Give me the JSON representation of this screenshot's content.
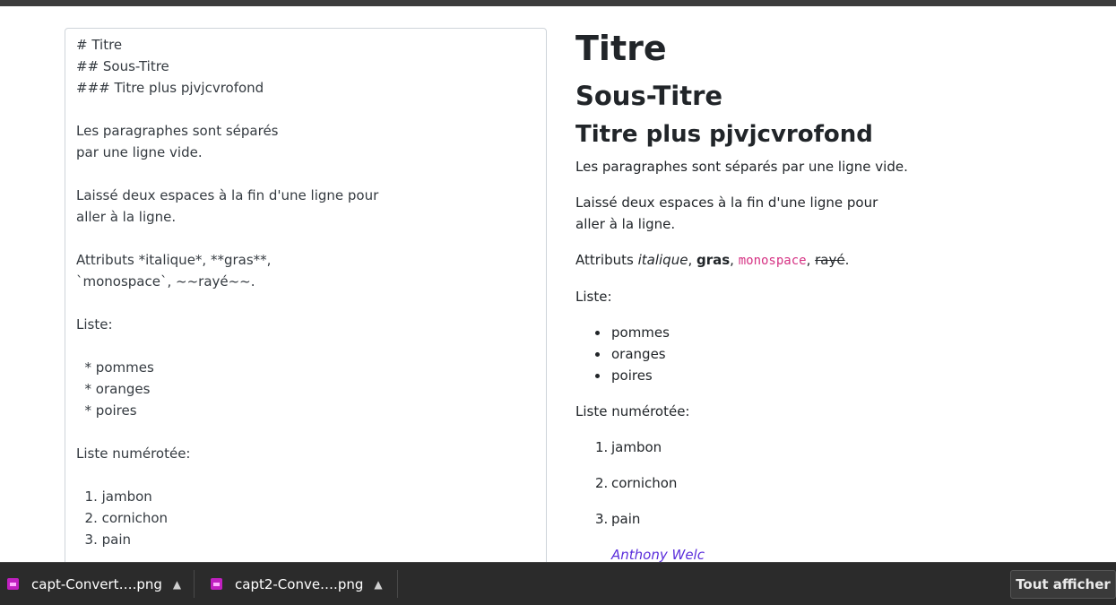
{
  "editor": {
    "lines": [
      "# Titre",
      "## Sous-Titre",
      "### Titre plus pjvjcvrofond",
      "",
      "Les paragraphes sont séparés",
      "par une ligne vide.",
      "",
      "Laissé deux espaces à la fin d'une ligne pour",
      "aller à la ligne.",
      "",
      "Attributs *italique*, **gras**,",
      "`monospace`, ~~rayé~~.",
      "",
      "Liste:",
      "",
      "  * pommes",
      "  * oranges",
      "  * poires",
      "",
      "Liste numérotée:",
      "",
      "  1. jambon",
      "  2. cornichon",
      "  3. pain"
    ]
  },
  "preview": {
    "h1": "Titre",
    "h2": "Sous-Titre",
    "h3": "Titre plus pjvjcvrofond",
    "para1": "Les paragraphes sont séparés par une ligne vide.",
    "para2_line1": "Laissé deux espaces à la fin d'une ligne pour",
    "para2_line2": "aller à la ligne.",
    "attrs_prefix": "Attributs ",
    "attrs_italic": "italique",
    "attrs_sep1": ", ",
    "attrs_bold": "gras",
    "attrs_sep2": ", ",
    "attrs_mono": "monospace",
    "attrs_sep3": ", ",
    "attrs_strike": "rayé",
    "attrs_end": ".",
    "list_label": "Liste:",
    "list_items": [
      "pommes",
      "oranges",
      "poires"
    ],
    "olist_label": "Liste numérotée:",
    "olist_numbers": [
      "1.",
      "2.",
      "3."
    ],
    "olist_items": [
      "jambon",
      "cornichon",
      "pain"
    ],
    "author": "Anthony Welc"
  },
  "downloads": {
    "items": [
      "capt-Convert….png",
      "capt2-Conve….png"
    ],
    "show_all": "Tout afficher",
    "icon": "image-file-icon",
    "chevron": "chevron-up-icon"
  }
}
